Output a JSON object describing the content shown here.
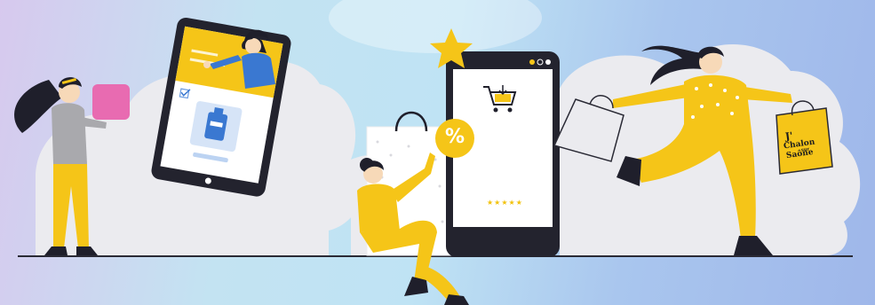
{
  "colors": {
    "yellow": "#f5c518",
    "dark": "#1f1f2b",
    "pink": "#e86bb1",
    "blue": "#3a78d1",
    "cloud": "#ececef"
  },
  "icons": [
    "star-icon",
    "shopping-cart-icon",
    "percent-badge-icon",
    "perfume-bottle-icon",
    "checkbox-icon"
  ],
  "phone": {
    "rating": "★★★★★"
  },
  "badge": {
    "symbol": "%"
  },
  "tote_bag": {
    "line1": "J'",
    "line2": "Chalon",
    "line3": "sur",
    "line4": "Saône"
  }
}
